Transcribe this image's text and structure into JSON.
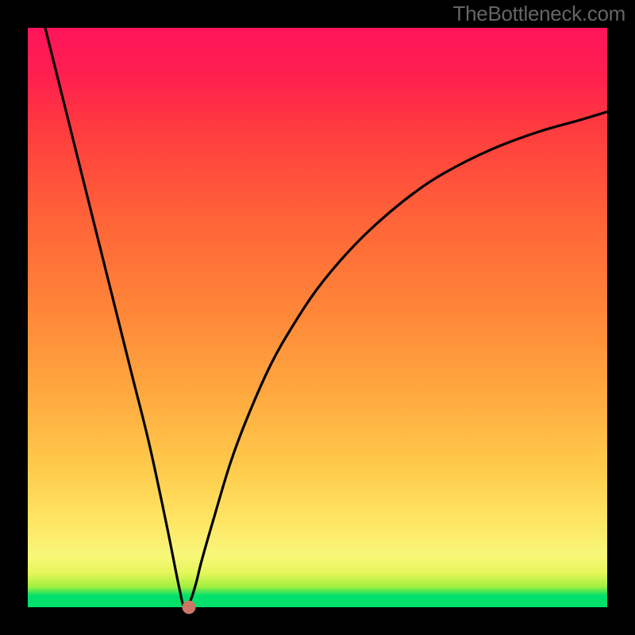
{
  "attribution": "TheBottleneck.com",
  "chart_data": {
    "type": "line",
    "title": "",
    "xlabel": "",
    "ylabel": "",
    "xlim": [
      0,
      100
    ],
    "ylim": [
      0,
      100
    ],
    "grid": false,
    "legend": false,
    "notes": "Bottleneck percentage curve with vertical gradient background (red=high bottleneck, green=no bottleneck). V-shaped curve with minimum near x≈27 indicating optimal balance. Marker dot at minimum.",
    "series": [
      {
        "name": "bottleneck-curve",
        "x": [
          0,
          3,
          6,
          9,
          12,
          15,
          18,
          21,
          24,
          26,
          27,
          28,
          29,
          30,
          32,
          35,
          38,
          42,
          46,
          50,
          55,
          60,
          66,
          72,
          80,
          88,
          95,
          100
        ],
        "values": [
          112,
          100,
          88,
          76,
          64,
          52,
          40,
          28,
          14,
          4,
          0,
          1,
          4,
          8,
          15,
          25,
          33,
          42,
          49,
          55,
          61,
          66,
          71,
          75,
          79,
          82,
          84,
          85.5
        ]
      }
    ],
    "marker": {
      "x": 27.8,
      "y": 0
    },
    "gradient_stops": [
      {
        "pct": 0,
        "color": "#00e06a"
      },
      {
        "pct": 2,
        "color": "#00e06a"
      },
      {
        "pct": 3.5,
        "color": "#9fef40"
      },
      {
        "pct": 6,
        "color": "#e8f65b"
      },
      {
        "pct": 9,
        "color": "#f7f77a"
      },
      {
        "pct": 15,
        "color": "#ffe563"
      },
      {
        "pct": 25,
        "color": "#ffc84a"
      },
      {
        "pct": 38,
        "color": "#ffa63e"
      },
      {
        "pct": 52,
        "color": "#ff8438"
      },
      {
        "pct": 67,
        "color": "#ff6338"
      },
      {
        "pct": 82,
        "color": "#ff3d3e"
      },
      {
        "pct": 92,
        "color": "#ff1f4f"
      },
      {
        "pct": 100,
        "color": "#ff145a"
      }
    ]
  }
}
